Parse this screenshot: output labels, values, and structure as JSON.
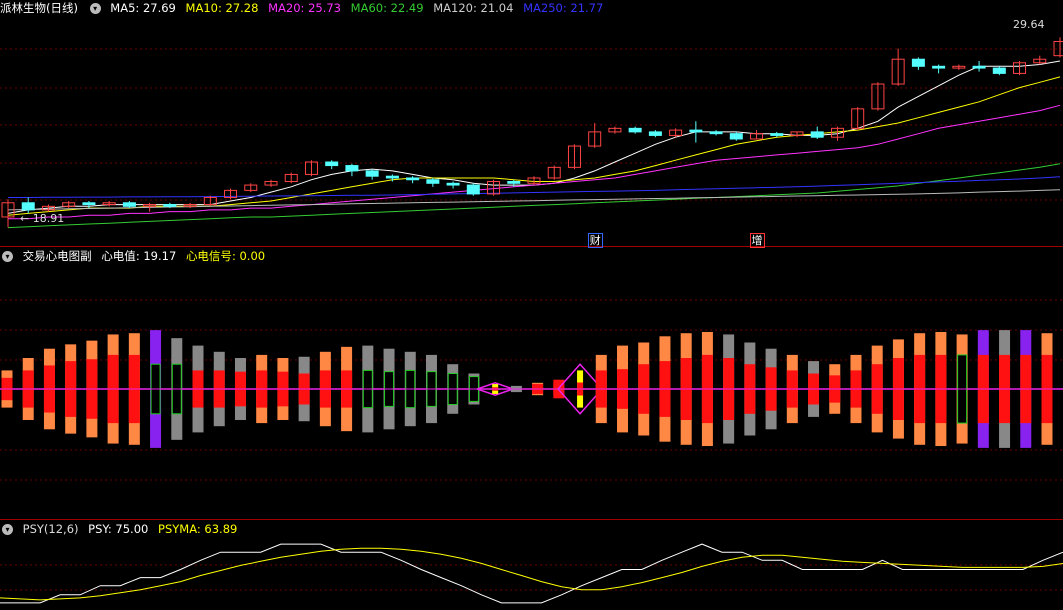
{
  "chart_data": [
    {
      "type": "candlestick",
      "title": "派林生物(日线)",
      "ma_legend": [
        {
          "name": "MA5",
          "value": "27.69",
          "color": "#ffffff"
        },
        {
          "name": "MA10",
          "value": "27.28",
          "color": "#ffff00"
        },
        {
          "name": "MA20",
          "value": "25.73",
          "color": "#ff33ff"
        },
        {
          "name": "MA60",
          "value": "22.49",
          "color": "#33cc33"
        },
        {
          "name": "MA120",
          "value": "21.04",
          "color": "#cccccc"
        },
        {
          "name": "MA250",
          "value": "21.77",
          "color": "#3333ff"
        }
      ],
      "high_label": "29.64",
      "low_label": "18.91",
      "ylim": [
        18.2,
        30.5
      ],
      "events": [
        {
          "text": "财",
          "index": 29,
          "color": "#ffffff",
          "border": "#3366ff"
        },
        {
          "text": "增",
          "index": 37,
          "color": "#ffffff",
          "border": "#ff3333"
        }
      ],
      "up_color": "#ff4444",
      "down_color": "#55ffff",
      "candles": [
        [
          19.5,
          20.3,
          20.5,
          18.91
        ],
        [
          20.3,
          19.9,
          20.6,
          19.7
        ],
        [
          19.9,
          20.1,
          20.2,
          19.8
        ],
        [
          20.1,
          20.3,
          20.4,
          20.0
        ],
        [
          20.3,
          20.2,
          20.4,
          20.0
        ],
        [
          20.2,
          20.3,
          20.4,
          20.1
        ],
        [
          20.3,
          20.1,
          20.4,
          20.0
        ],
        [
          20.1,
          20.2,
          20.3,
          19.8
        ],
        [
          20.2,
          20.1,
          20.3,
          20.0
        ],
        [
          20.1,
          20.2,
          20.3,
          20.0
        ],
        [
          20.2,
          20.6,
          20.7,
          20.1
        ],
        [
          20.6,
          21.0,
          21.1,
          20.5
        ],
        [
          21.0,
          21.3,
          21.4,
          20.9
        ],
        [
          21.3,
          21.5,
          21.6,
          21.2
        ],
        [
          21.5,
          21.9,
          22.0,
          21.4
        ],
        [
          21.9,
          22.6,
          22.7,
          21.8
        ],
        [
          22.6,
          22.4,
          22.7,
          22.2
        ],
        [
          22.4,
          22.1,
          22.5,
          21.8
        ],
        [
          22.1,
          21.8,
          22.2,
          21.6
        ],
        [
          21.8,
          21.7,
          21.9,
          21.5
        ],
        [
          21.7,
          21.6,
          21.8,
          21.4
        ],
        [
          21.6,
          21.4,
          21.7,
          21.2
        ],
        [
          21.4,
          21.3,
          21.5,
          21.1
        ],
        [
          21.3,
          20.8,
          21.4,
          20.7
        ],
        [
          20.8,
          21.5,
          21.6,
          20.7
        ],
        [
          21.5,
          21.4,
          21.6,
          21.2
        ],
        [
          21.4,
          21.7,
          21.8,
          21.3
        ],
        [
          21.7,
          22.3,
          22.4,
          21.6
        ],
        [
          22.3,
          23.5,
          23.6,
          22.2
        ],
        [
          23.5,
          24.3,
          24.8,
          23.4
        ],
        [
          24.3,
          24.5,
          24.6,
          24.2
        ],
        [
          24.5,
          24.3,
          24.6,
          24.2
        ],
        [
          24.3,
          24.1,
          24.4,
          24.0
        ],
        [
          24.1,
          24.4,
          24.5,
          24.0
        ],
        [
          24.4,
          24.3,
          24.9,
          23.7
        ],
        [
          24.3,
          24.2,
          24.4,
          24.1
        ],
        [
          24.2,
          23.9,
          24.3,
          23.8
        ],
        [
          23.9,
          24.2,
          24.4,
          23.9
        ],
        [
          24.2,
          24.1,
          24.3,
          24.0
        ],
        [
          24.1,
          24.3,
          24.3,
          24.0
        ],
        [
          24.3,
          24.0,
          24.6,
          23.9
        ],
        [
          24.0,
          24.5,
          24.6,
          23.8
        ],
        [
          24.5,
          25.6,
          25.7,
          24.4
        ],
        [
          25.6,
          27.0,
          27.1,
          25.5
        ],
        [
          27.0,
          28.4,
          29.0,
          26.9
        ],
        [
          28.4,
          28.0,
          28.5,
          27.8
        ],
        [
          28.0,
          27.9,
          28.1,
          27.6
        ],
        [
          27.9,
          28.0,
          28.1,
          27.8
        ],
        [
          28.0,
          27.9,
          28.3,
          27.7
        ],
        [
          27.9,
          27.6,
          28.0,
          27.5
        ],
        [
          27.6,
          28.2,
          28.3,
          27.5
        ],
        [
          28.2,
          28.4,
          28.6,
          28.1
        ],
        [
          28.6,
          29.4,
          29.64,
          28.5
        ]
      ],
      "ma": {
        "ma5": [
          19.7,
          19.9,
          20.0,
          20.1,
          20.1,
          20.2,
          20.2,
          20.2,
          20.2,
          20.2,
          20.2,
          20.4,
          20.6,
          20.9,
          21.2,
          21.6,
          21.9,
          22.1,
          22.2,
          22.1,
          21.9,
          21.7,
          21.6,
          21.4,
          21.3,
          21.3,
          21.3,
          21.4,
          21.7,
          22.1,
          22.6,
          23.1,
          23.6,
          24.0,
          24.3,
          24.3,
          24.3,
          24.2,
          24.2,
          24.1,
          24.1,
          24.2,
          24.5,
          24.9,
          25.7,
          26.3,
          26.9,
          27.5,
          28.0,
          28.0,
          28.0,
          28.1,
          28.3
        ],
        "ma10": [
          19.6,
          19.7,
          19.8,
          19.9,
          20.0,
          20.0,
          20.0,
          20.1,
          20.1,
          20.1,
          20.1,
          20.2,
          20.3,
          20.4,
          20.6,
          20.8,
          21.0,
          21.2,
          21.4,
          21.6,
          21.7,
          21.7,
          21.7,
          21.7,
          21.7,
          21.6,
          21.5,
          21.5,
          21.6,
          21.7,
          21.9,
          22.1,
          22.4,
          22.7,
          23.0,
          23.3,
          23.6,
          23.8,
          24.0,
          24.1,
          24.2,
          24.3,
          24.4,
          24.6,
          24.8,
          25.1,
          25.4,
          25.7,
          26.0,
          26.4,
          26.8,
          27.1,
          27.4
        ],
        "ma20": [
          19.4,
          19.4,
          19.5,
          19.5,
          19.6,
          19.6,
          19.7,
          19.7,
          19.8,
          19.8,
          19.9,
          19.9,
          20.0,
          20.0,
          20.1,
          20.2,
          20.3,
          20.4,
          20.5,
          20.6,
          20.7,
          20.8,
          20.9,
          21.0,
          21.1,
          21.2,
          21.3,
          21.4,
          21.5,
          21.6,
          21.7,
          21.9,
          22.1,
          22.3,
          22.5,
          22.7,
          22.8,
          22.9,
          23.0,
          23.1,
          23.2,
          23.3,
          23.4,
          23.6,
          23.9,
          24.2,
          24.5,
          24.7,
          24.9,
          25.1,
          25.3,
          25.5,
          25.8
        ],
        "ma60": [
          18.9,
          18.95,
          19.0,
          19.05,
          19.1,
          19.15,
          19.2,
          19.25,
          19.3,
          19.35,
          19.4,
          19.45,
          19.5,
          19.5,
          19.55,
          19.6,
          19.65,
          19.7,
          19.75,
          19.8,
          19.85,
          19.9,
          19.95,
          20.0,
          20.05,
          20.1,
          20.15,
          20.2,
          20.25,
          20.3,
          20.35,
          20.4,
          20.45,
          20.5,
          20.55,
          20.6,
          20.65,
          20.7,
          20.75,
          20.8,
          20.85,
          20.95,
          21.05,
          21.15,
          21.25,
          21.4,
          21.55,
          21.7,
          21.85,
          22.0,
          22.15,
          22.3,
          22.5
        ],
        "ma120": [
          19.9,
          19.92,
          19.94,
          19.96,
          19.98,
          20.0,
          20.02,
          20.04,
          20.06,
          20.08,
          20.1,
          20.12,
          20.14,
          20.16,
          20.18,
          20.2,
          20.22,
          20.24,
          20.26,
          20.28,
          20.3,
          20.32,
          20.34,
          20.36,
          20.38,
          20.4,
          20.42,
          20.44,
          20.46,
          20.48,
          20.5,
          20.52,
          20.54,
          20.56,
          20.58,
          20.6,
          20.62,
          20.64,
          20.66,
          20.68,
          20.7,
          20.72,
          20.74,
          20.76,
          20.78,
          20.8,
          20.83,
          20.86,
          20.9,
          20.93,
          20.96,
          21.0,
          21.04
        ],
        "ma250": [
          20.6,
          20.6,
          20.61,
          20.61,
          20.62,
          20.62,
          20.63,
          20.63,
          20.64,
          20.64,
          20.65,
          20.66,
          20.67,
          20.68,
          20.69,
          20.7,
          20.71,
          20.72,
          20.73,
          20.74,
          20.76,
          20.78,
          20.8,
          20.82,
          20.84,
          20.86,
          20.88,
          20.9,
          20.92,
          20.94,
          20.96,
          20.98,
          21.0,
          21.03,
          21.06,
          21.09,
          21.12,
          21.15,
          21.18,
          21.21,
          21.24,
          21.28,
          21.32,
          21.36,
          21.4,
          21.44,
          21.48,
          21.52,
          21.56,
          21.6,
          21.64,
          21.7,
          21.77
        ]
      }
    },
    {
      "type": "bar",
      "title": "交易心电图副",
      "legend": [
        {
          "name": "心电值",
          "value": "19.17",
          "color": "#ffffff"
        },
        {
          "name": "心电信号",
          "value": "0.00",
          "color": "#ffff00"
        }
      ],
      "colors": {
        "o": "#ff8844",
        "g": "#888888",
        "p": "#8822ee",
        "G": "#22cc22",
        "r": "#ff1111",
        "y": "#ffff00",
        "m": "#ee22ee"
      },
      "bars": [
        {
          "o": 0.3,
          "i": 0.18,
          "c": "o"
        },
        {
          "o": 0.5,
          "i": 0.3,
          "c": "o"
        },
        {
          "o": 0.65,
          "i": 0.38,
          "c": "o"
        },
        {
          "o": 0.72,
          "i": 0.45,
          "c": "o"
        },
        {
          "o": 0.78,
          "i": 0.48,
          "c": "o"
        },
        {
          "o": 0.88,
          "i": 0.55,
          "c": "o"
        },
        {
          "o": 0.9,
          "i": 0.55,
          "c": "o"
        },
        {
          "o": 0.95,
          "i": 0.4,
          "c": "p",
          "h": "G"
        },
        {
          "o": 0.82,
          "i": 0.4,
          "c": "g",
          "h": "G"
        },
        {
          "o": 0.7,
          "i": 0.3,
          "c": "g"
        },
        {
          "o": 0.6,
          "i": 0.3,
          "c": "g"
        },
        {
          "o": 0.5,
          "i": 0.28,
          "c": "g"
        },
        {
          "o": 0.55,
          "i": 0.3,
          "c": "o"
        },
        {
          "o": 0.5,
          "i": 0.28,
          "c": "o"
        },
        {
          "o": 0.52,
          "i": 0.25,
          "c": "g"
        },
        {
          "o": 0.6,
          "i": 0.3,
          "c": "o"
        },
        {
          "o": 0.68,
          "i": 0.3,
          "c": "o"
        },
        {
          "o": 0.7,
          "i": 0.3,
          "c": "g",
          "h": "G"
        },
        {
          "o": 0.65,
          "i": 0.28,
          "c": "g",
          "h": "G"
        },
        {
          "o": 0.6,
          "i": 0.3,
          "c": "g",
          "h": "G"
        },
        {
          "o": 0.55,
          "i": 0.28,
          "c": "g",
          "h": "G"
        },
        {
          "o": 0.4,
          "i": 0.25,
          "c": "g",
          "h": "G"
        },
        {
          "o": 0.25,
          "i": 0.2,
          "c": "g",
          "h": "G"
        },
        {
          "o": 0.1,
          "i": 0.08,
          "c": "y",
          "d": "m"
        },
        {
          "o": 0.05,
          "i": 0.04,
          "c": "g"
        },
        {
          "o": 0.1,
          "i": 0.08,
          "c": "o"
        },
        {
          "o": 0.15,
          "i": 0.1,
          "c": "r"
        },
        {
          "o": 0.4,
          "i": 0.3,
          "c": "y",
          "d": "m",
          "big": true
        },
        {
          "o": 0.55,
          "i": 0.3,
          "c": "o"
        },
        {
          "o": 0.7,
          "i": 0.32,
          "c": "o"
        },
        {
          "o": 0.75,
          "i": 0.4,
          "c": "o"
        },
        {
          "o": 0.85,
          "i": 0.45,
          "c": "o"
        },
        {
          "o": 0.9,
          "i": 0.5,
          "c": "o"
        },
        {
          "o": 0.92,
          "i": 0.55,
          "c": "o"
        },
        {
          "o": 0.88,
          "i": 0.5,
          "c": "g"
        },
        {
          "o": 0.75,
          "i": 0.4,
          "c": "g"
        },
        {
          "o": 0.65,
          "i": 0.35,
          "c": "g"
        },
        {
          "o": 0.55,
          "i": 0.3,
          "c": "o"
        },
        {
          "o": 0.45,
          "i": 0.25,
          "c": "g"
        },
        {
          "o": 0.4,
          "i": 0.22,
          "c": "o"
        },
        {
          "o": 0.55,
          "i": 0.3,
          "c": "o"
        },
        {
          "o": 0.7,
          "i": 0.4,
          "c": "o"
        },
        {
          "o": 0.8,
          "i": 0.5,
          "c": "o"
        },
        {
          "o": 0.9,
          "i": 0.55,
          "c": "o"
        },
        {
          "o": 0.92,
          "i": 0.55,
          "c": "o"
        },
        {
          "o": 0.88,
          "i": 0.55,
          "c": "o",
          "h": "G"
        },
        {
          "o": 0.95,
          "i": 0.55,
          "c": "p"
        },
        {
          "o": 0.95,
          "i": 0.55,
          "c": "g"
        },
        {
          "o": 0.95,
          "i": 0.55,
          "c": "p"
        },
        {
          "o": 0.9,
          "i": 0.55,
          "c": "o"
        }
      ]
    },
    {
      "type": "line",
      "title": "PSY(12,6)",
      "legend": [
        {
          "name": "PSY",
          "value": "75.00",
          "color": "#ffffff"
        },
        {
          "name": "PSYMA",
          "value": "63.89",
          "color": "#ffff00"
        }
      ],
      "ylim": [
        20,
        90
      ],
      "series": [
        {
          "name": "PSY",
          "color": "#ffffff",
          "values": [
            25,
            25,
            25,
            33,
            33,
            42,
            42,
            50,
            50,
            58,
            67,
            75,
            75,
            75,
            83,
            83,
            83,
            75,
            75,
            75,
            67,
            58,
            50,
            42,
            33,
            25,
            25,
            25,
            33,
            42,
            50,
            58,
            58,
            67,
            75,
            83,
            75,
            75,
            67,
            67,
            58,
            58,
            58,
            58,
            67,
            58,
            58,
            58,
            58,
            58,
            58,
            58,
            67,
            75
          ]
        },
        {
          "name": "PSYMA",
          "color": "#ffff00",
          "values": [
            30,
            29,
            28,
            29,
            30,
            32,
            35,
            38,
            42,
            46,
            52,
            57,
            62,
            66,
            70,
            73,
            76,
            78,
            79,
            79,
            78,
            76,
            73,
            69,
            64,
            58,
            52,
            46,
            41,
            38,
            38,
            41,
            45,
            50,
            55,
            61,
            66,
            70,
            72,
            72,
            70,
            68,
            66,
            65,
            64,
            63,
            62,
            61,
            60,
            60,
            60,
            60,
            61,
            63.89
          ]
        }
      ]
    }
  ]
}
